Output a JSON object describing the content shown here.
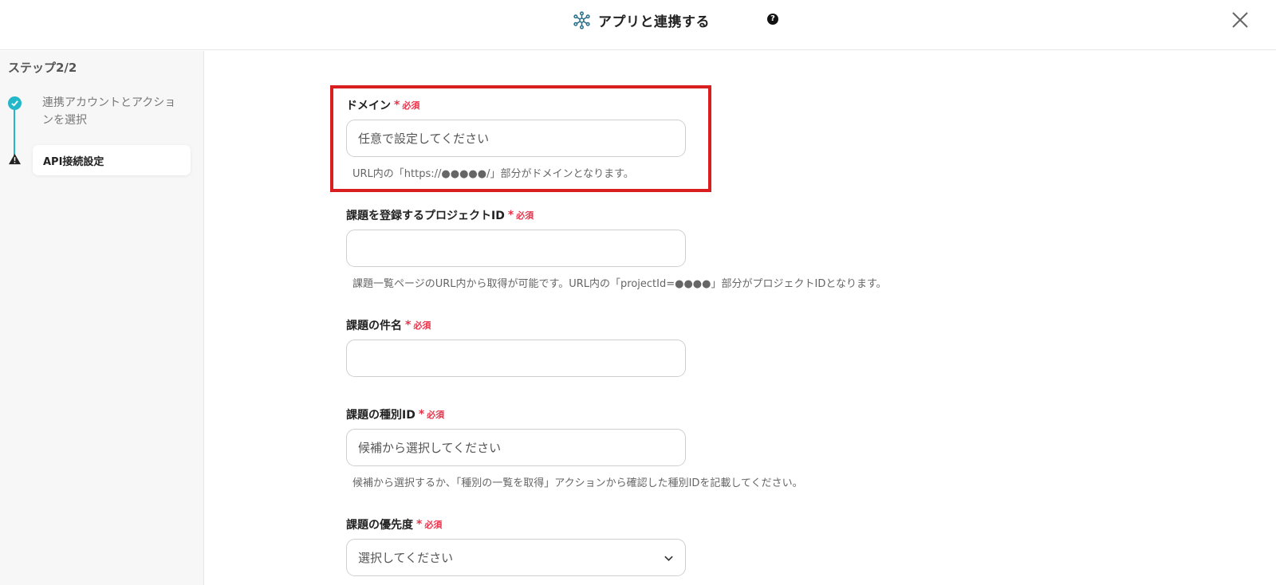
{
  "header": {
    "title": "アプリと連携する",
    "help_icon": "question-circle-icon",
    "close_icon": "close-x-icon"
  },
  "sidebar": {
    "step_title": "ステップ2/2",
    "steps": [
      {
        "label": "連携アカウントとアクションを選択",
        "status": "done",
        "icon": "check-circle-icon"
      },
      {
        "label": "API接続設定",
        "status": "current",
        "icon": "warning-triangle-icon"
      }
    ]
  },
  "form": {
    "required_text": "必須",
    "fields": [
      {
        "label": "ドメイン",
        "placeholder": "任意で設定してください",
        "value": "",
        "hint": "URL内の「https://●●●●●/」部分がドメインとなります。"
      },
      {
        "label": "課題を登録するプロジェクトID",
        "placeholder": "",
        "value": "",
        "hint": "課題一覧ページのURL内から取得が可能です。URL内の「projectId=●●●●」部分がプロジェクトIDとなります。"
      },
      {
        "label": "課題の件名",
        "placeholder": "",
        "value": ""
      },
      {
        "label": "課題の種別ID",
        "placeholder": "候補から選択してください",
        "value": "",
        "hint": "候補から選択するか、「種別の一覧を取得」アクションから確認した種別IDを記載してください。"
      },
      {
        "label": "課題の優先度",
        "selected": "選択してください"
      }
    ]
  },
  "colors": {
    "accent": "#23b7c9",
    "required": "#e8334a",
    "highlight": "#d81e1e"
  }
}
